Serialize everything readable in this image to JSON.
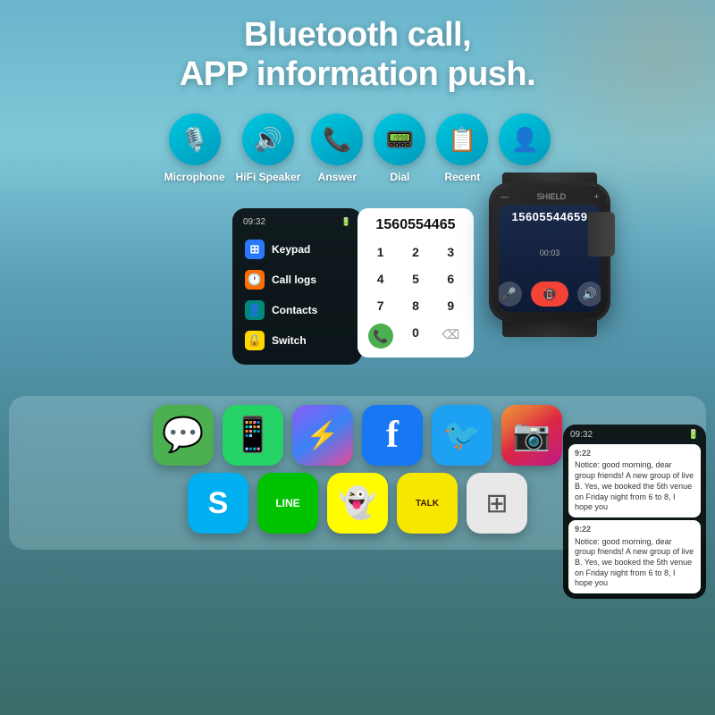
{
  "header": {
    "title_line1": "Bluetooth call,",
    "title_line2": "APP information push."
  },
  "features": [
    {
      "id": "microphone",
      "label": "Microphone",
      "icon": "🎙️",
      "color": "#00b8d4"
    },
    {
      "id": "hifi-speaker",
      "label": "HiFi Speaker",
      "icon": "🔊",
      "color": "#00b8d4"
    },
    {
      "id": "answer",
      "label": "Answer",
      "icon": "📞",
      "color": "#00b8d4"
    },
    {
      "id": "dial",
      "label": "Dial",
      "icon": "📟",
      "color": "#00b8d4"
    },
    {
      "id": "recent",
      "label": "Recent",
      "icon": "📋",
      "color": "#00b8d4"
    },
    {
      "id": "contacts",
      "label": "Contacts",
      "icon": "👤",
      "color": "#00b8d4"
    }
  ],
  "phone_menu": {
    "time": "09:32",
    "battery": "□",
    "items": [
      {
        "label": "Keypad",
        "icon": "⊞",
        "color": "#2979ff"
      },
      {
        "label": "Call logs",
        "icon": "🕐",
        "color": "#ff6d00"
      },
      {
        "label": "Contacts",
        "icon": "👤",
        "color": "#00897b"
      },
      {
        "label": "Switch",
        "icon": "🔒",
        "color": "#ffd600"
      }
    ]
  },
  "dialer": {
    "number": "1560554465",
    "keys": [
      "1",
      "2",
      "3",
      "4",
      "5",
      "6",
      "7",
      "8",
      "9",
      "",
      "0",
      ""
    ]
  },
  "watch": {
    "number": "15605544659",
    "duration": "00:03"
  },
  "apps_row1": [
    {
      "label": "Messages",
      "icon": "💬",
      "bg": "#4caf50"
    },
    {
      "label": "WhatsApp",
      "icon": "💬",
      "bg": "#25d366"
    },
    {
      "label": "Messenger",
      "icon": "💬",
      "bg": "#8b5cf6"
    },
    {
      "label": "Facebook",
      "icon": "f",
      "bg": "#1877f2"
    },
    {
      "label": "Twitter",
      "icon": "🐦",
      "bg": "#1da1f2"
    },
    {
      "label": "Instagram",
      "icon": "📷",
      "bg": "#e1306c"
    }
  ],
  "apps_row2": [
    {
      "label": "Skype",
      "icon": "S",
      "bg": "#00aff0"
    },
    {
      "label": "LINE",
      "icon": "LINE",
      "bg": "#00c300"
    },
    {
      "label": "Snapchat",
      "icon": "👻",
      "bg": "#fffc00"
    },
    {
      "label": "KakaoTalk",
      "icon": "TALK",
      "bg": "#f7e600"
    },
    {
      "label": "Grid",
      "icon": "⊞",
      "bg": "#f0f0f0"
    }
  ],
  "notifications": {
    "time": "09:32",
    "messages": [
      {
        "time": "9:22",
        "text": "Notice: good morning, dear group friends! A new group of live B. Yes, we booked the 5th venue on Friday night from 6 to 8, I hope you"
      },
      {
        "time": "9:22",
        "text": "Notice: good morning, dear group friends! A new group of live B. Yes, we booked the 5th venue on Friday night from 6 to 8, I hope you"
      }
    ]
  }
}
